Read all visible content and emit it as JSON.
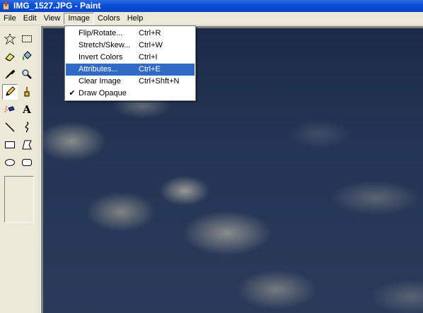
{
  "window": {
    "title": "IMG_1527.JPG - Paint"
  },
  "menubar": {
    "items": [
      "File",
      "Edit",
      "View",
      "Image",
      "Colors",
      "Help"
    ],
    "active_index": 3
  },
  "image_menu": {
    "items": [
      {
        "label": "Flip/Rotate...",
        "shortcut": "Ctrl+R",
        "checked": false,
        "highlighted": false
      },
      {
        "label": "Stretch/Skew...",
        "shortcut": "Ctrl+W",
        "checked": false,
        "highlighted": false
      },
      {
        "label": "Invert Colors",
        "shortcut": "Ctrl+I",
        "checked": false,
        "highlighted": false
      },
      {
        "label": "Attributes...",
        "shortcut": "Ctrl+E",
        "checked": false,
        "highlighted": true
      },
      {
        "label": "Clear Image",
        "shortcut": "Ctrl+Shft+N",
        "checked": false,
        "highlighted": false
      },
      {
        "label": "Draw Opaque",
        "shortcut": "",
        "checked": true,
        "highlighted": false
      }
    ],
    "check_glyph": "✔"
  },
  "toolbox": {
    "tools": [
      "free-form-select-icon",
      "select-icon",
      "eraser-icon",
      "fill-with-color-icon",
      "pick-color-icon",
      "magnifier-icon",
      "pencil-icon",
      "brush-icon",
      "airbrush-icon",
      "text-icon",
      "line-icon",
      "curve-icon",
      "rectangle-icon",
      "polygon-icon",
      "ellipse-icon",
      "rounded-rectangle-icon"
    ],
    "selected_tool": "pencil-icon",
    "text_tool_glyph": "A"
  },
  "colors": {
    "titlebar": "#0a50d8",
    "highlight": "#316ac5",
    "chrome": "#ece9d8"
  }
}
